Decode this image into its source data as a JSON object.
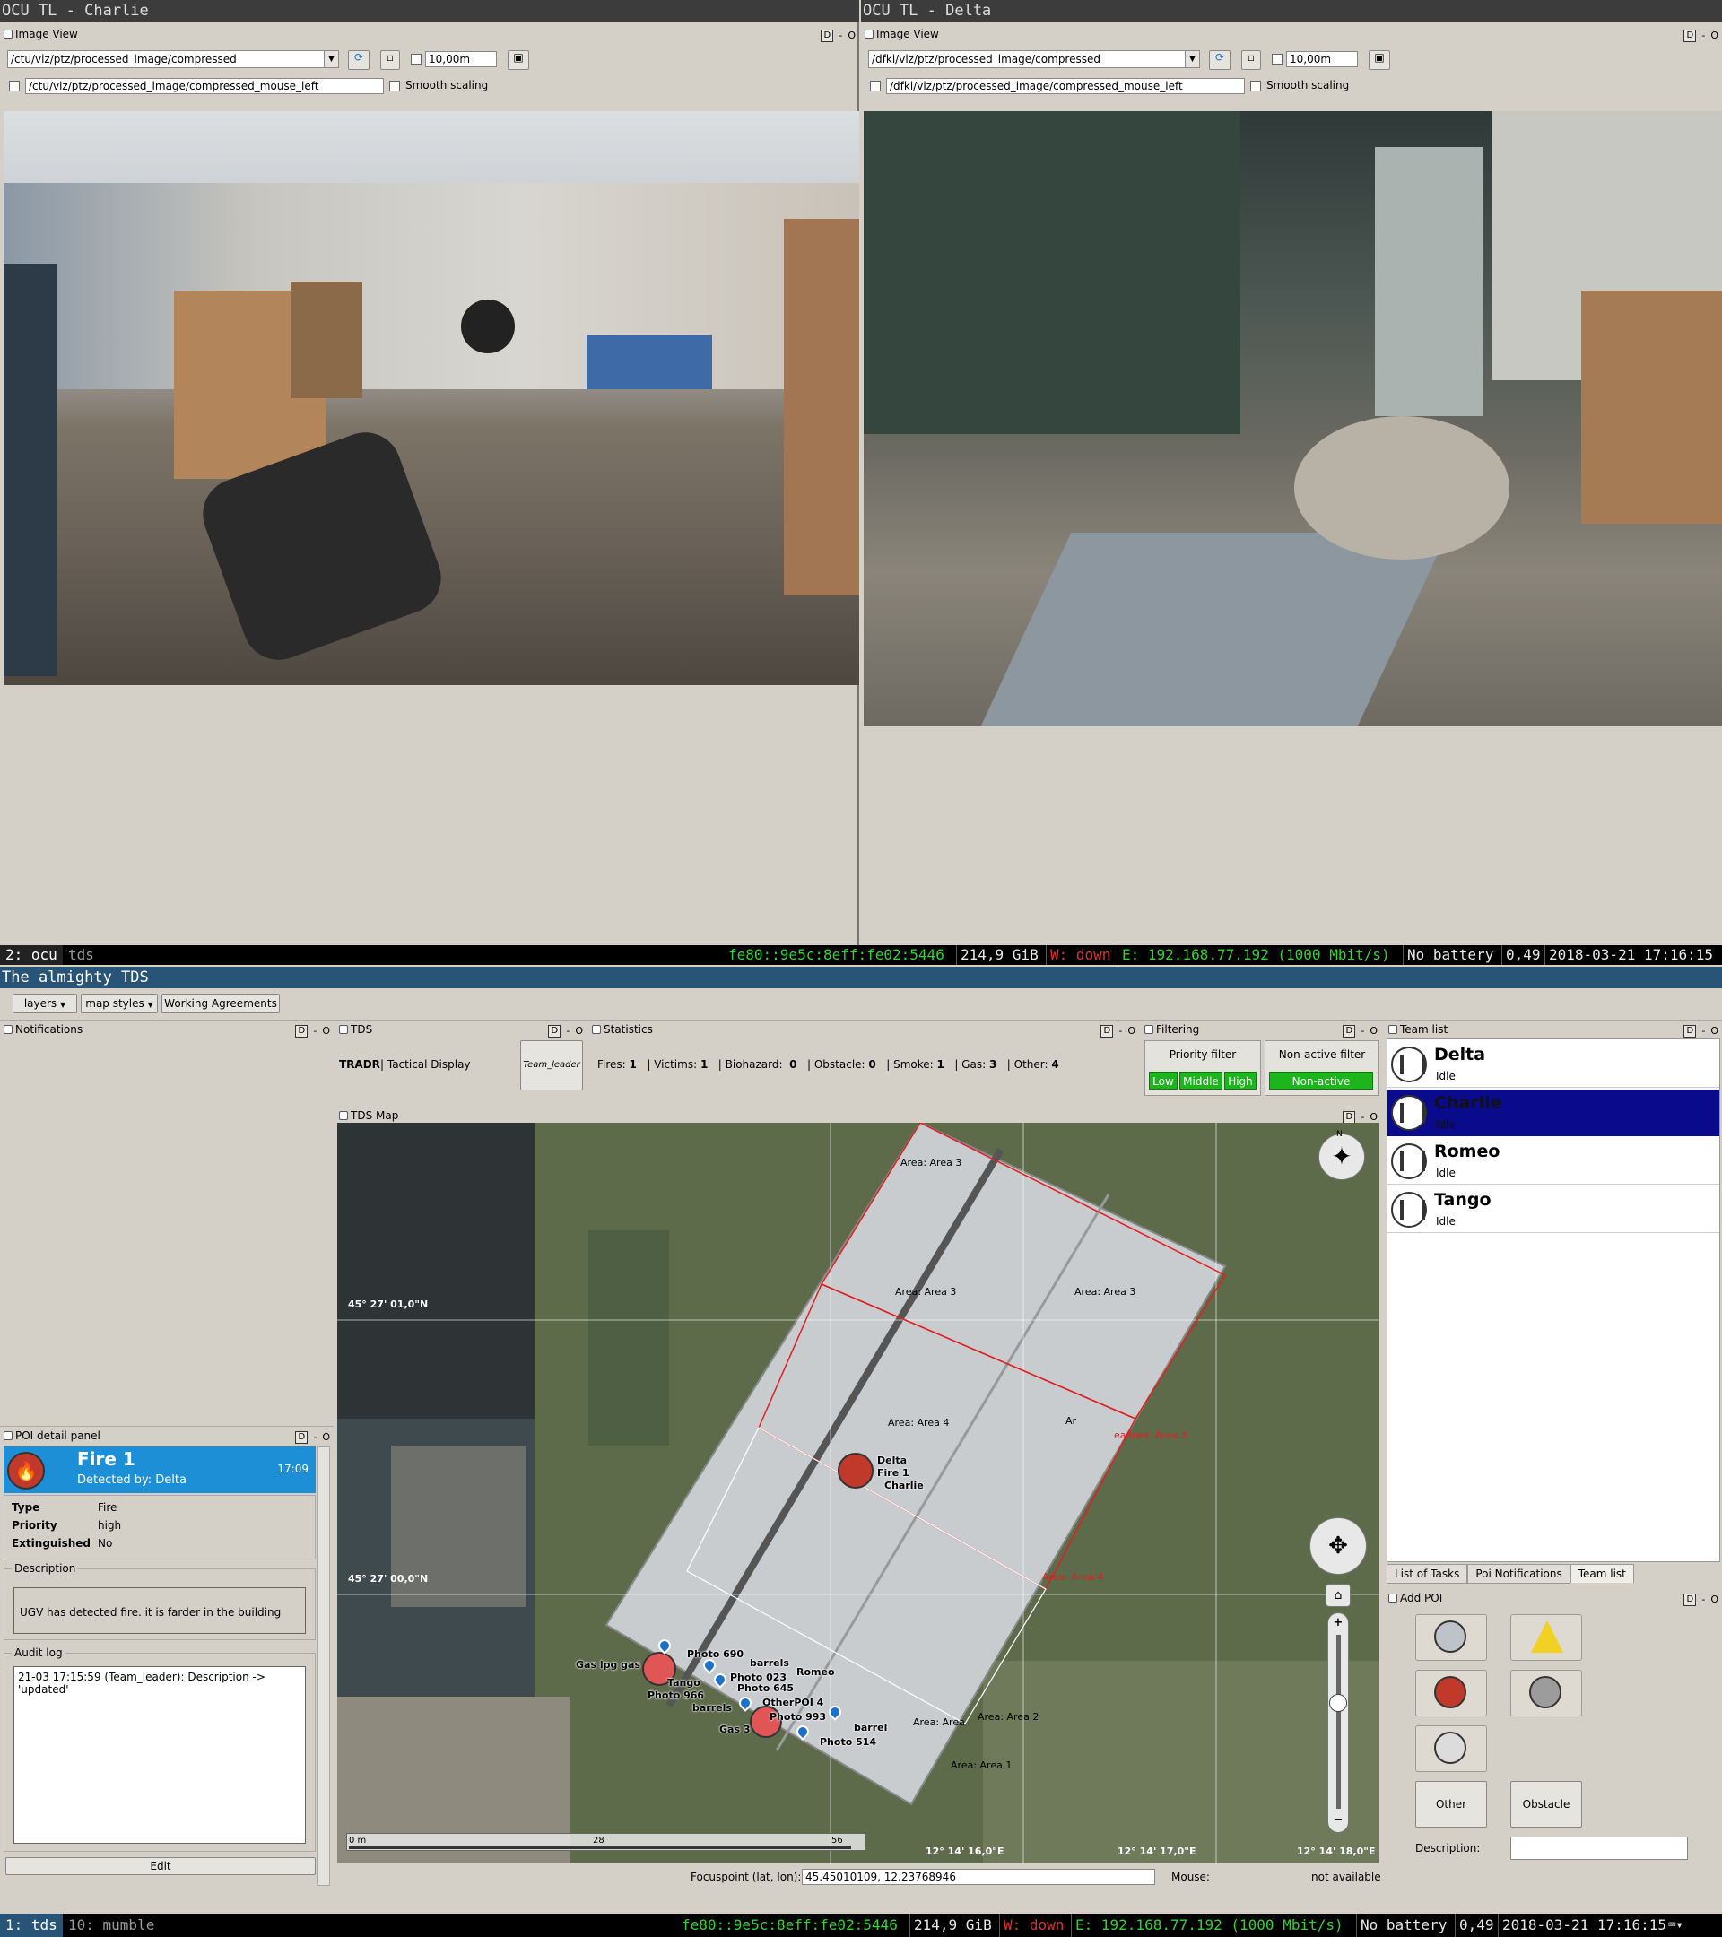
{
  "top_left": {
    "window_title": "OCU TL - Charlie",
    "panel_title": "Image View",
    "topic": "/ctu/viz/ptz/processed_image/compressed",
    "zoom": "10,00m",
    "mouse_topic": "/ctu/viz/ptz/processed_image/compressed_mouse_left",
    "smooth_label": "Smooth scaling",
    "ctl": "D"
  },
  "top_right": {
    "window_title": "OCU TL - Delta",
    "panel_title": "Image View",
    "topic": "/dfki/viz/ptz/processed_image/compressed",
    "zoom": "10,00m",
    "mouse_topic": "/dfki/viz/ptz/processed_image/compressed_mouse_left",
    "smooth_label": "Smooth scaling",
    "ctl": "D"
  },
  "status_top": {
    "workspace_active": "2: ocu",
    "workspace_other": "tds",
    "ipv6": "fe80::9e5c:8eff:fe02:5446",
    "disk": "214,9 GiB",
    "wifi": "W: down",
    "eth": "E: 192.168.77.192 (1000 Mbit/s)",
    "battery": "No battery",
    "load": "0,49",
    "datetime": "2018-03-21 17:16:15"
  },
  "tds": {
    "window_title": "The almighty TDS",
    "toolbar": {
      "layers": "layers",
      "map_styles": "map styles",
      "working_agreements": "Working Agreements"
    },
    "notifications_title": "Notifications",
    "tds_title": "TDS",
    "tradr_bold": "TRADR",
    "tradr_rest": "| Tactical Display",
    "role": "Team_leader",
    "statistics_title": "Statistics",
    "stats": [
      {
        "label": "Fires:",
        "value": "1"
      },
      {
        "label": "| Victims:",
        "value": "1"
      },
      {
        "label": "| Biohazard:",
        "value": "0"
      },
      {
        "label": "| Obstacle:",
        "value": "0"
      },
      {
        "label": "| Smoke:",
        "value": "1"
      },
      {
        "label": "| Gas:",
        "value": "3"
      },
      {
        "label": "| Other:",
        "value": "4"
      }
    ],
    "filtering_title": "Filtering",
    "priority_filter": "Priority filter",
    "priority_levels": [
      "Low",
      "Middle",
      "High"
    ],
    "nonactive_filter": "Non-active filter",
    "nonactive_btn": "Non-active",
    "team_list_title": "Team list",
    "team": [
      {
        "name": "Delta",
        "status": "Idle"
      },
      {
        "name": "Charlie",
        "status": "Idle"
      },
      {
        "name": "Romeo",
        "status": "Idle"
      },
      {
        "name": "Tango",
        "status": "Idle"
      }
    ],
    "team_tabs": [
      "List of Tasks",
      "Poi Notifications",
      "Team list"
    ],
    "add_poi_title": "Add POI",
    "add_poi_other": "Other",
    "add_poi_obstacle": "Obstacle",
    "add_poi_desc": "Description:",
    "map_title": "TDS Map",
    "map_lat1": "45° 27' 01,0\"N",
    "map_lat2": "45° 27' 00,0\"N",
    "map_lon1": "12° 14' 16,0\"E",
    "map_lon2": "12° 14' 17,0\"E",
    "map_lon3": "12° 14' 18,0\"E",
    "map_north": "N",
    "scale": [
      "0 m",
      "28",
      "56"
    ],
    "areas": [
      "Area: Area 3",
      "Area: Area 3",
      "Area: Area 3",
      "Area: Area 4",
      "Ar",
      "eaArea: Area 3",
      "Area: Area 4",
      "Area: Area",
      "Area: Area 2",
      "Area: Area 1"
    ],
    "markers": [
      "Delta",
      "Fire 1",
      "Charlie",
      "Gas lpg gas",
      "Photo 690",
      "barrels",
      "Romeo",
      "Photo 023",
      "Tango",
      "Photo 645",
      "Photo 966",
      "OtherPOI 4",
      "barrels",
      "Photo 993",
      "Gas 3",
      "barrel",
      "Photo 514"
    ],
    "focus_label": "Focuspoint (lat, lon):",
    "focus_value": "45.45010109, 12.23768946",
    "mouse_label": "Mouse:",
    "mouse_value": "not available",
    "poi_detail_title": "POI detail panel",
    "poi": {
      "name": "Fire 1",
      "time": "17:09",
      "detected": "Detected by: Delta",
      "type_label": "Type",
      "type": "Fire",
      "priority_label": "Priority",
      "priority": "high",
      "ext_label": "Extinguished",
      "ext": "No",
      "desc_label": "Description",
      "desc": "UGV has detected fire. it is farder in the building",
      "audit_label": "Audit log",
      "audit": "21-03 17:15:59 (Team_leader): Description -> 'updated'",
      "edit": "Edit"
    }
  },
  "status_bottom": {
    "workspace_active": "1: tds",
    "workspace_other": "10: mumble",
    "ipv6": "fe80::9e5c:8eff:fe02:5446",
    "disk": "214,9 GiB",
    "wifi": "W: down",
    "eth": "E: 192.168.77.192 (1000 Mbit/s)",
    "battery": "No battery",
    "load": "0,49",
    "datetime": "2018-03-21 17:16:15"
  },
  "colors": {
    "accent": "#1d8fd6",
    "selected": "#0a0a8c",
    "filter_green": "#1db41d",
    "status_green": "#2fd42f",
    "status_red": "#e03030"
  }
}
